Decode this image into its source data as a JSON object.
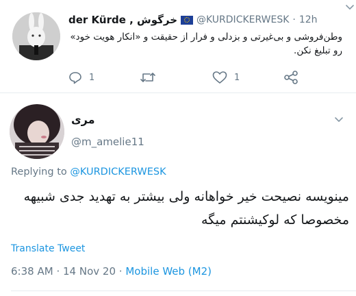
{
  "parent_tweet": {
    "display_name": "der Kürde , خرگوش",
    "handle": "@KURDICKERWESK",
    "separator": "·",
    "time": "12h",
    "text": "وطن‌فروشی و بی‌غیرتی و بزدلی و فرار از حقیقت و «انکار هویت خود» رو تبلیغ نکن.",
    "reply_count": "1",
    "like_count": "1",
    "icons": [
      "eu-flag-icon",
      "reply-icon",
      "retweet-icon",
      "like-icon",
      "share-icon",
      "chevron-down-icon"
    ]
  },
  "reply_tweet": {
    "display_name": "مری",
    "handle": "@m_amelie11",
    "replying_prefix": "Replying to",
    "replying_to": "@KURDICKERWESK",
    "text": "مینویسه نصیحت خیر خواهانه ولی بیشتر به تهدید جدی شبیهه مخصوصا که لوکیشنتم میگه",
    "translate_label": "Translate Tweet",
    "time": "6:38 AM",
    "sep1": "·",
    "date": "14 Nov 20",
    "sep2": "·",
    "source": "Mobile Web (M2)"
  },
  "colors": {
    "link_blue": "#1b95e0",
    "secondary_gray": "#657786",
    "text_dark": "#14171a",
    "divider": "#e6ecf0"
  }
}
